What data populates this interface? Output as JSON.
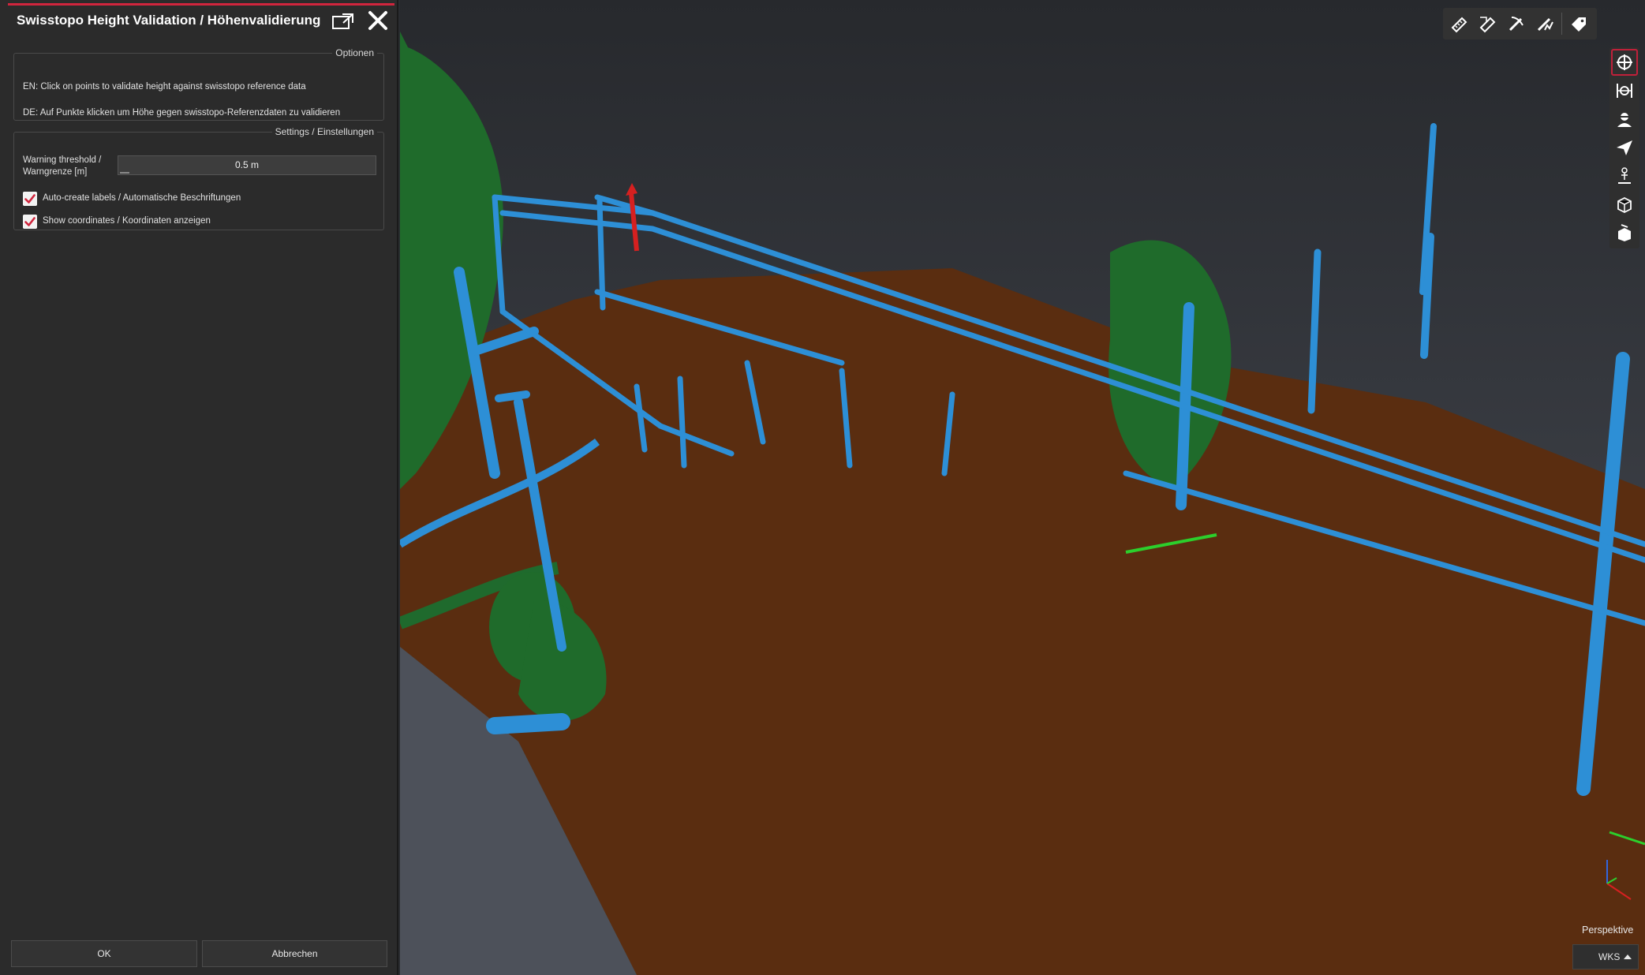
{
  "dialog": {
    "title": "Swisstopo Height Validation / Höhenvalidierung",
    "options_group": {
      "legend": "Optionen",
      "line_en": "EN: Click on points to validate height against swisstopo reference data",
      "line_de": "DE: Auf Punkte klicken um Höhe gegen swisstopo-Referenzdaten zu validieren"
    },
    "settings_group": {
      "legend": "Settings / Einstellungen",
      "threshold_label_1": "Warning threshold /",
      "threshold_label_2": "Warngrenze [m]",
      "threshold_value": "0.5 m",
      "autolabels_label": "Auto-create labels / Automatische Beschriftungen",
      "autolabels_checked": true,
      "coords_label": "Show coordinates / Koordinaten anzeigen",
      "coords_checked": true
    },
    "ok_label": "OK",
    "cancel_label": "Abbrechen"
  },
  "viewport": {
    "projection_label": "Perspektive",
    "coord_system": "WKS",
    "top_tools": [
      "measure-distance-icon",
      "measure-area-icon",
      "measure-height-icon",
      "measure-profile-icon",
      "label-tag-icon"
    ],
    "side_tools": [
      "orbit-icon",
      "fit-view-icon",
      "walk-person-icon",
      "fly-plane-icon",
      "first-person-icon",
      "box-view-icon",
      "clip-box-icon"
    ]
  },
  "colors": {
    "accent": "#d0253d",
    "ground": "#5c2e0f",
    "vegetation": "#1e6b2a",
    "structures": "#2d8fd6",
    "background": "#2b2d32"
  }
}
